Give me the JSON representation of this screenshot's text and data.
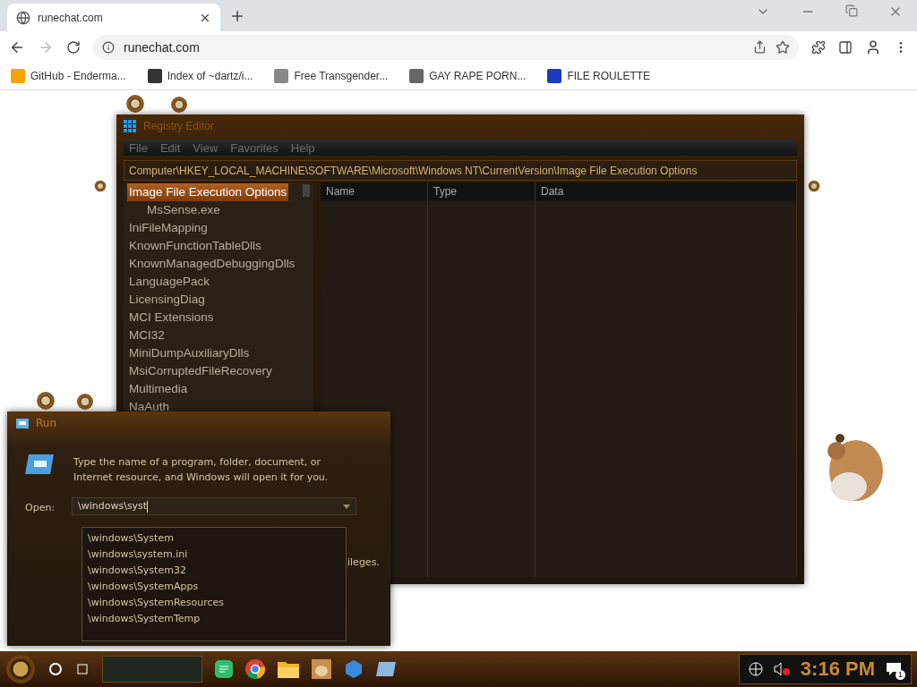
{
  "browser": {
    "tab": {
      "title": "runechat.com"
    },
    "address": "runechat.com",
    "bookmarks": [
      {
        "label": "GitHub - Enderma..."
      },
      {
        "label": "Index of ~dartz/i..."
      },
      {
        "label": "Free Transgender..."
      },
      {
        "label": "GAY RAPE PORN..."
      },
      {
        "label": "FILE ROULETTE"
      }
    ]
  },
  "registry": {
    "title": "Registry Editor",
    "menu": [
      "File",
      "Edit",
      "View",
      "Favorites",
      "Help"
    ],
    "address": "Computer\\HKEY_LOCAL_MACHINE\\SOFTWARE\\Microsoft\\Windows NT\\CurrentVersion\\Image File Execution Options",
    "tree": [
      {
        "label": "Image File Execution Options",
        "selected": true,
        "children": [
          {
            "label": "MsSense.exe",
            "selected": false
          }
        ]
      },
      {
        "label": "IniFileMapping",
        "selected": false
      },
      {
        "label": "KnownFunctionTableDlls",
        "selected": false
      },
      {
        "label": "KnownManagedDebuggingDlls",
        "selected": false
      },
      {
        "label": "LanguagePack",
        "selected": false
      },
      {
        "label": "LicensingDiag",
        "selected": false
      },
      {
        "label": "MCI Extensions",
        "selected": false
      },
      {
        "label": "MCI32",
        "selected": false
      },
      {
        "label": "MiniDumpAuxiliaryDlls",
        "selected": false
      },
      {
        "label": "MsiCorruptedFileRecovery",
        "selected": false
      },
      {
        "label": "Multimedia",
        "selected": false
      },
      {
        "label": "NaAuth",
        "selected": false
      }
    ],
    "columns": [
      "Name",
      "Type",
      "Data"
    ]
  },
  "run": {
    "title": "Run",
    "description": "Type the name of a program, folder, document, or Internet resource, and Windows will open it for you.",
    "open_label": "Open:",
    "value": "\\windows\\syst",
    "partial_text": "ileges.",
    "suggestions": [
      "\\windows\\System",
      "\\windows\\system.ini",
      "\\windows\\System32",
      "\\windows\\SystemApps",
      "\\windows\\SystemResources",
      "\\windows\\SystemTemp"
    ]
  },
  "taskbar": {
    "clock": "3:16 PM",
    "notification_count": "1",
    "volume_muted": true
  }
}
